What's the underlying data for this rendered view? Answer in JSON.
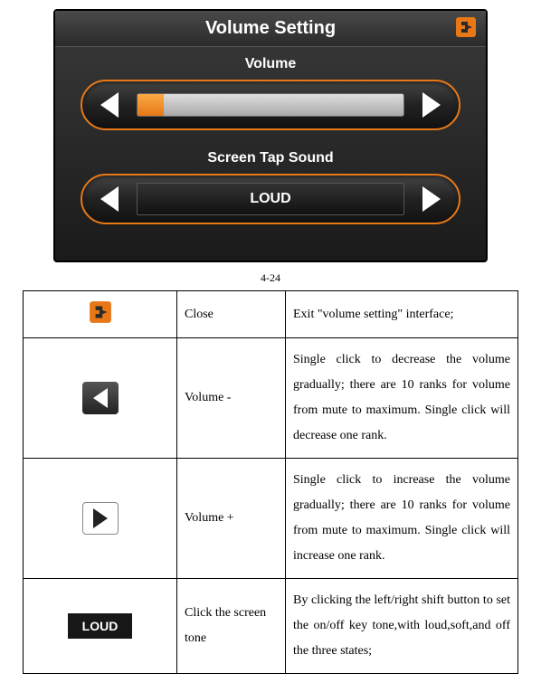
{
  "screen": {
    "title": "Volume Setting",
    "volume": {
      "label": "Volume",
      "level": 1,
      "max": 10,
      "fill_percent": 10
    },
    "tap_sound": {
      "label": "Screen Tap Sound",
      "value": "LOUD",
      "options": [
        "LOUD",
        "SOFT",
        "OFF"
      ]
    }
  },
  "figure_number": "4-24",
  "table": {
    "rows": [
      {
        "name": "Close",
        "desc": "Exit \"volume setting\" interface;"
      },
      {
        "name": "Volume -",
        "desc": "Single click to decrease the volume gradually; there are 10 ranks for volume from mute to maximum. Single click will decrease one rank."
      },
      {
        "name": "Volume +",
        "desc": "Single click to increase the volume gradually; there are 10 ranks for volume from mute to maximum. Single click will increase one rank."
      },
      {
        "name": "Click the screen tone",
        "desc": "By clicking the left/right shift button to set the on/off key tone,with loud,soft,and off the three states;"
      }
    ],
    "loud_badge": "LOUD"
  }
}
